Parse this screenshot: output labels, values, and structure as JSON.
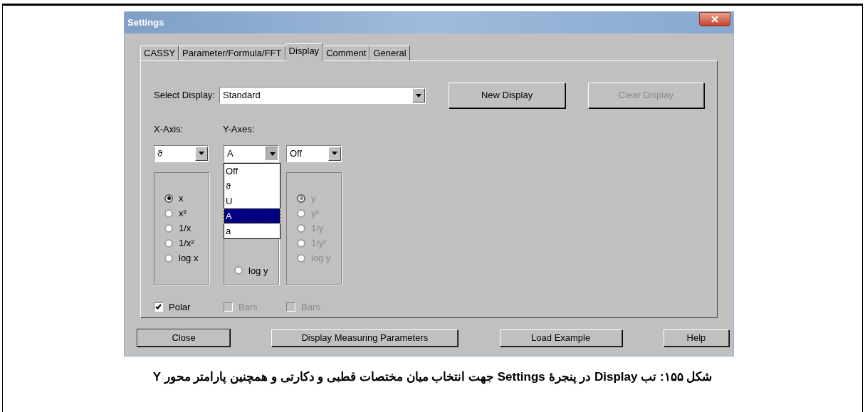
{
  "window": {
    "title": "Settings"
  },
  "tabs": [
    {
      "label": "CASSY",
      "selected": false
    },
    {
      "label": "Parameter/Formula/FFT",
      "selected": false
    },
    {
      "label": "Display",
      "selected": true
    },
    {
      "label": "Comment",
      "selected": false
    },
    {
      "label": "General",
      "selected": false
    }
  ],
  "select_display": {
    "label": "Select Display:",
    "value": "Standard"
  },
  "display_buttons": [
    {
      "label": "New Display",
      "disabled": false
    },
    {
      "label": "Clear Display",
      "disabled": true
    }
  ],
  "x_axis": {
    "label": "X-Axis:",
    "value": "ϑ",
    "disabled": false,
    "expanded": false,
    "radios": [
      {
        "label": "x",
        "selected": true,
        "disabled": false
      },
      {
        "label": "x²",
        "selected": false,
        "disabled": false
      },
      {
        "label": "1/x",
        "selected": false,
        "disabled": false
      },
      {
        "label": "1/x²",
        "selected": false,
        "disabled": false
      },
      {
        "label": "log x",
        "selected": false,
        "disabled": false
      }
    ],
    "checkbox": {
      "label": "Polar",
      "checked": true,
      "disabled": false
    }
  },
  "y_axes": {
    "label": "Y-Axes:",
    "columns": [
      {
        "value": "A",
        "disabled": false,
        "expanded": true,
        "options": [
          {
            "label": "Off",
            "selected": false
          },
          {
            "label": "ϑ",
            "selected": false
          },
          {
            "label": "U",
            "selected": false
          },
          {
            "label": "A",
            "selected": true
          },
          {
            "label": "a",
            "selected": false
          }
        ],
        "radios": [
          {
            "label": "log y",
            "selected": false,
            "disabled": false
          }
        ],
        "checkbox": {
          "label": "Bars",
          "checked": false,
          "disabled": true
        }
      },
      {
        "value": "Off",
        "disabled": false,
        "expanded": false,
        "radios": [
          {
            "label": "y",
            "selected": true,
            "disabled": true
          },
          {
            "label": "y²",
            "selected": false,
            "disabled": true
          },
          {
            "label": "1/y",
            "selected": false,
            "disabled": true
          },
          {
            "label": "1/y²",
            "selected": false,
            "disabled": true
          },
          {
            "label": "log y",
            "selected": false,
            "disabled": true
          }
        ],
        "checkbox": {
          "label": "Bars",
          "checked": false,
          "disabled": true
        }
      }
    ]
  },
  "buttons": [
    {
      "label": "Close",
      "default": true
    },
    {
      "label": "Display Measuring Parameters",
      "default": false
    },
    {
      "label": "Load Example",
      "default": false
    },
    {
      "label": "Help",
      "default": false
    }
  ],
  "caption": "شکل ۱۵۵: تب Display در پنجرۀ Settings جهت انتخاب میان مختصات قطبی و دکارتی و همچنین پارامتر محور Y"
}
